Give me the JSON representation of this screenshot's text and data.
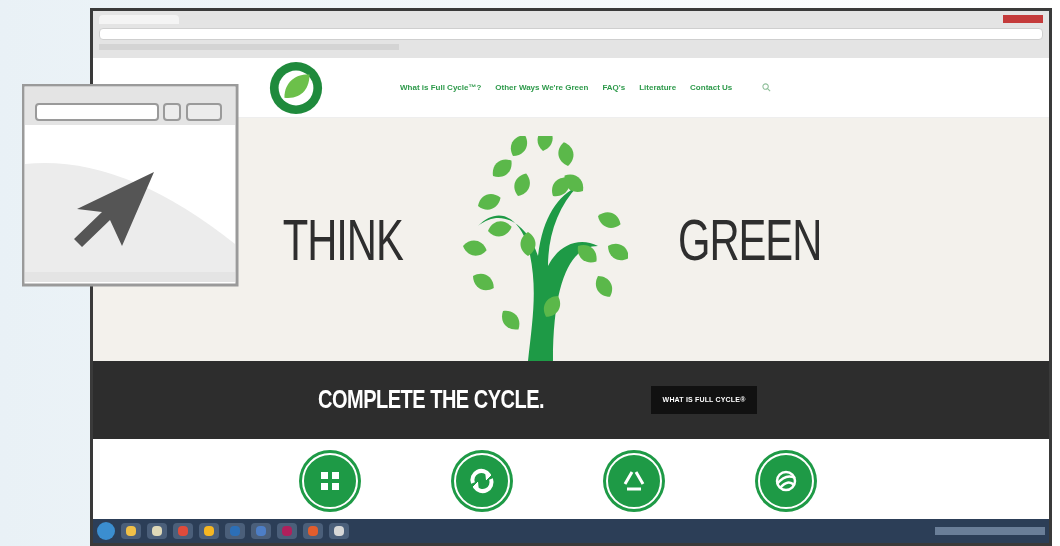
{
  "nav": {
    "items": [
      {
        "label": "What is Full Cycle™?"
      },
      {
        "label": "Other Ways We're Green"
      },
      {
        "label": "FAQ's"
      },
      {
        "label": "Literature"
      },
      {
        "label": "Contact Us"
      }
    ]
  },
  "hero": {
    "left_word": "THINK",
    "right_word": "GREEN"
  },
  "banner": {
    "headline": "COMPLETE THE CYCLE.",
    "button": "WHAT IS FULL CYCLE®"
  },
  "features": [
    {
      "kind": "grid"
    },
    {
      "kind": "refresh"
    },
    {
      "kind": "recycle"
    },
    {
      "kind": "globe"
    }
  ]
}
